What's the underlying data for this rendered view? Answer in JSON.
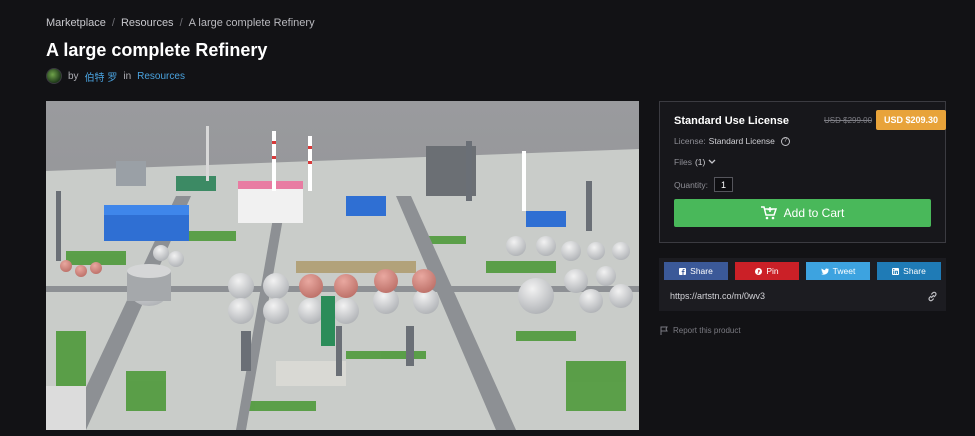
{
  "breadcrumb": {
    "items": [
      "Marketplace",
      "Resources",
      "A large complete Refinery"
    ],
    "separator": "/"
  },
  "product": {
    "title": "A large complete Refinery",
    "by_label": "by",
    "author": "伯特 罗",
    "in_label": "in",
    "category": "Resources"
  },
  "license": {
    "title": "Standard Use License",
    "old_price": "USD $299.00",
    "price": "USD $209.30",
    "license_label": "License:",
    "license_value": "Standard License",
    "files_label": "Files",
    "files_count": "(1)",
    "quantity_label": "Quantity:",
    "quantity_value": "1",
    "add_to_cart": "Add to Cart"
  },
  "share": {
    "facebook": "Share",
    "pinterest": "Pin",
    "twitter": "Tweet",
    "linkedin": "Share",
    "short_url": "https://artstn.co/m/0wv3"
  },
  "report_label": "Report this product",
  "colors": {
    "background": "#121215",
    "accent_price": "#e8a33a",
    "cart_green": "#49b85a",
    "link_blue": "#4aa3df",
    "facebook": "#3b5998",
    "pinterest": "#cb2027",
    "twitter": "#3da3e0",
    "linkedin": "#1f7bb6"
  },
  "icons": [
    "question-icon",
    "chevron-down-icon",
    "cart-icon",
    "facebook-icon",
    "pinterest-icon",
    "twitter-icon",
    "linkedin-icon",
    "link-icon",
    "flag-icon"
  ]
}
